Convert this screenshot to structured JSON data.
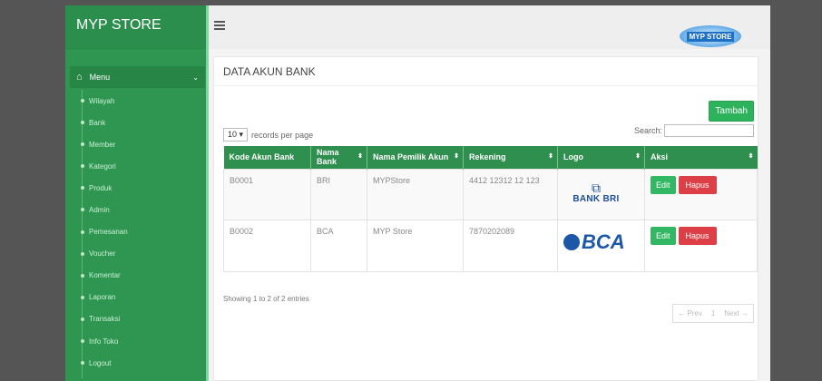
{
  "brand": "MYP STORE",
  "logo_text": "MYP STORE",
  "sidebar": {
    "menu_label": "Menu",
    "items": [
      "Wilayah",
      "Bank",
      "Member",
      "Kategori",
      "Produk",
      "Admin",
      "Pemesanan",
      "Voucher",
      "Komentar",
      "Laporan",
      "Transaksi",
      "Info Toko",
      "Logout"
    ]
  },
  "page": {
    "title": "DATA AKUN BANK",
    "add_button": "Tambah",
    "records_select": "10",
    "records_label": "records per page",
    "search_label": "Search:",
    "showing": "Showing 1 to 2 of 2 entries",
    "pager": {
      "prev": "← Prev",
      "current": "1",
      "next": "Next →"
    }
  },
  "table": {
    "headers": [
      "Kode Akun Bank",
      "Nama Bank",
      "Nama Pemilik Akun",
      "Rekening",
      "Logo",
      "Aksi"
    ],
    "rows": [
      {
        "kode": "B0001",
        "bank": "BRI",
        "pemilik": "MYPStore",
        "rekening": "4412 12312 12 123",
        "logo_text": "BANK BRI",
        "edit": "Edit",
        "hapus": "Hapus"
      },
      {
        "kode": "B0002",
        "bank": "BCA",
        "pemilik": "MYP Store",
        "rekening": "7870202089",
        "logo_text": "BCA",
        "edit": "Edit",
        "hapus": "Hapus"
      }
    ]
  },
  "icons": {
    "menu": "hamburger-icon",
    "home": "home-icon",
    "chevron": "chevron-down-icon",
    "sort": "sort-icon"
  },
  "colors": {
    "sidebar": "#2e9651",
    "table_header": "#2e8f4e",
    "add_button": "#2db35c",
    "edit_button": "#34b765",
    "delete_button": "#dc3f45"
  }
}
